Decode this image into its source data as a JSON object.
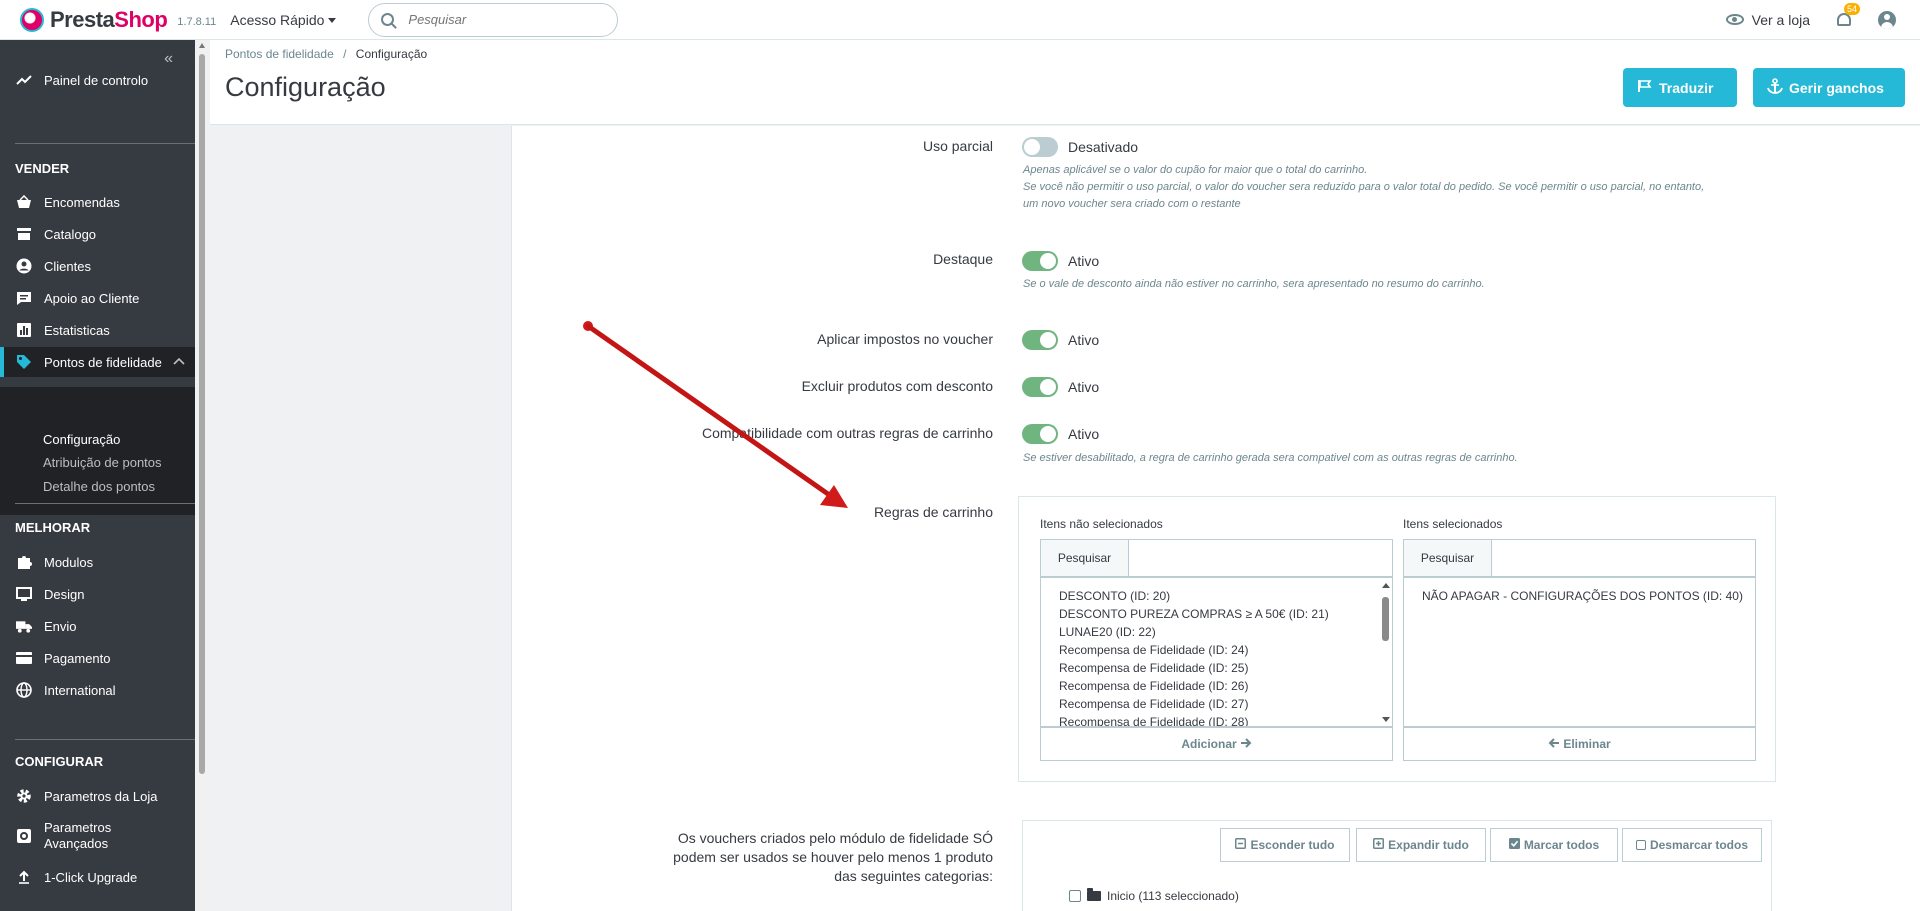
{
  "header": {
    "brand_pre": "Presta",
    "brand_post": "Shop",
    "version": "1.7.8.11",
    "quick_access": "Acesso Rápido",
    "search_placeholder": "Pesquisar",
    "view_shop": "Ver a loja",
    "notifications_count": "54"
  },
  "sidebar": {
    "collapse_glyph": "«",
    "dashboard": "Painel de controlo",
    "sections": {
      "sell": "VENDER",
      "improve": "MELHORAR",
      "configure": "CONFIGURAR"
    },
    "sell_items": [
      {
        "label": "Encomendas",
        "icon": "basket-icon"
      },
      {
        "label": "Catalogo",
        "icon": "store-icon"
      },
      {
        "label": "Clientes",
        "icon": "user-circle-icon"
      },
      {
        "label": "Apoio ao Cliente",
        "icon": "chat-icon"
      },
      {
        "label": "Estatisticas",
        "icon": "bar-chart-icon"
      },
      {
        "label": "Pontos de fidelidade",
        "icon": "tag-icon"
      }
    ],
    "loyalty_sub": [
      "Configuração",
      "Atribuição de pontos",
      "Detalhe dos pontos"
    ],
    "improve_items": [
      {
        "label": "Modulos",
        "icon": "puzzle-icon"
      },
      {
        "label": "Design",
        "icon": "monitor-icon"
      },
      {
        "label": "Envio",
        "icon": "truck-icon"
      },
      {
        "label": "Pagamento",
        "icon": "card-icon"
      },
      {
        "label": "International",
        "icon": "globe-icon"
      }
    ],
    "configure_items": [
      {
        "label": "Parametros da Loja",
        "icon": "gear-icon"
      },
      {
        "label": "Parametros Avançados",
        "icon": "settings-box-icon"
      },
      {
        "label": "1-Click Upgrade",
        "icon": "upload-icon"
      }
    ]
  },
  "page": {
    "breadcrumb_parent": "Pontos de fidelidade",
    "breadcrumb_sep": "/",
    "breadcrumb_current": "Configuração",
    "title": "Configuração",
    "btn_translate": "Traduzir",
    "btn_hooks": "Gerir ganchos"
  },
  "form": {
    "partial_use": {
      "label": "Uso parcial",
      "state": "Desativado",
      "help": [
        "Apenas aplicável se o valor do cupão for maior que o total do carrinho.",
        "Se você não permitir o uso parcial, o valor do voucher sera reduzido para o valor total do pedido. Se você permitir o uso parcial, no entanto,",
        "um novo voucher sera criado com o restante"
      ]
    },
    "highlight": {
      "label": "Destaque",
      "state": "Ativo",
      "help": "Se o vale de desconto ainda não estiver no carrinho, sera apresentado no resumo do carrinho."
    },
    "apply_taxes": {
      "label": "Aplicar impostos no voucher",
      "state": "Ativo"
    },
    "exclude_discounted": {
      "label": "Excluir produtos com desconto",
      "state": "Ativo"
    },
    "compatibility": {
      "label": "Compatibilidade com outras regras de carrinho",
      "state": "Ativo",
      "help": "Se estiver desabilitado, a regra de carrinho gerada sera compativel com as outras regras de carrinho."
    },
    "cart_rules": {
      "label": "Regras de carrinho",
      "unselected_title": "Itens não selecionados",
      "selected_title": "Itens selecionados",
      "search_addon": "Pesquisar",
      "unselected_items": [
        "DESCONTO (ID: 20)",
        "DESCONTO PUREZA COMPRAS ≥ A 50€ (ID: 21)",
        "LUNAE20 (ID: 22)",
        "Recompensa de Fidelidade (ID: 24)",
        "Recompensa de Fidelidade (ID: 25)",
        "Recompensa de Fidelidade (ID: 26)",
        "Recompensa de Fidelidade (ID: 27)",
        "Recompensa de Fidelidade (ID: 28)"
      ],
      "selected_items": [
        "NÃO APAGAR - CONFIGURAÇÕES DOS PONTOS (ID: 40)"
      ],
      "add_label": "Adicionar",
      "remove_label": "Eliminar"
    },
    "categories": {
      "label_lines": [
        "Os vouchers criados pelo módulo de fidelidade SÓ",
        "podem ser usados se houver pelo menos 1 produto",
        "das seguintes categorias:"
      ],
      "collapse_all": "Esconder tudo",
      "expand_all": "Expandir tudo",
      "check_all": "Marcar todos",
      "uncheck_all": "Desmarcar todos",
      "root_item": "Inicio (113 seleccionado)"
    }
  },
  "colors": {
    "accent": "#25b9d7",
    "toggle_on": "#70b580",
    "annotation_arrow": "#d11a1a"
  }
}
